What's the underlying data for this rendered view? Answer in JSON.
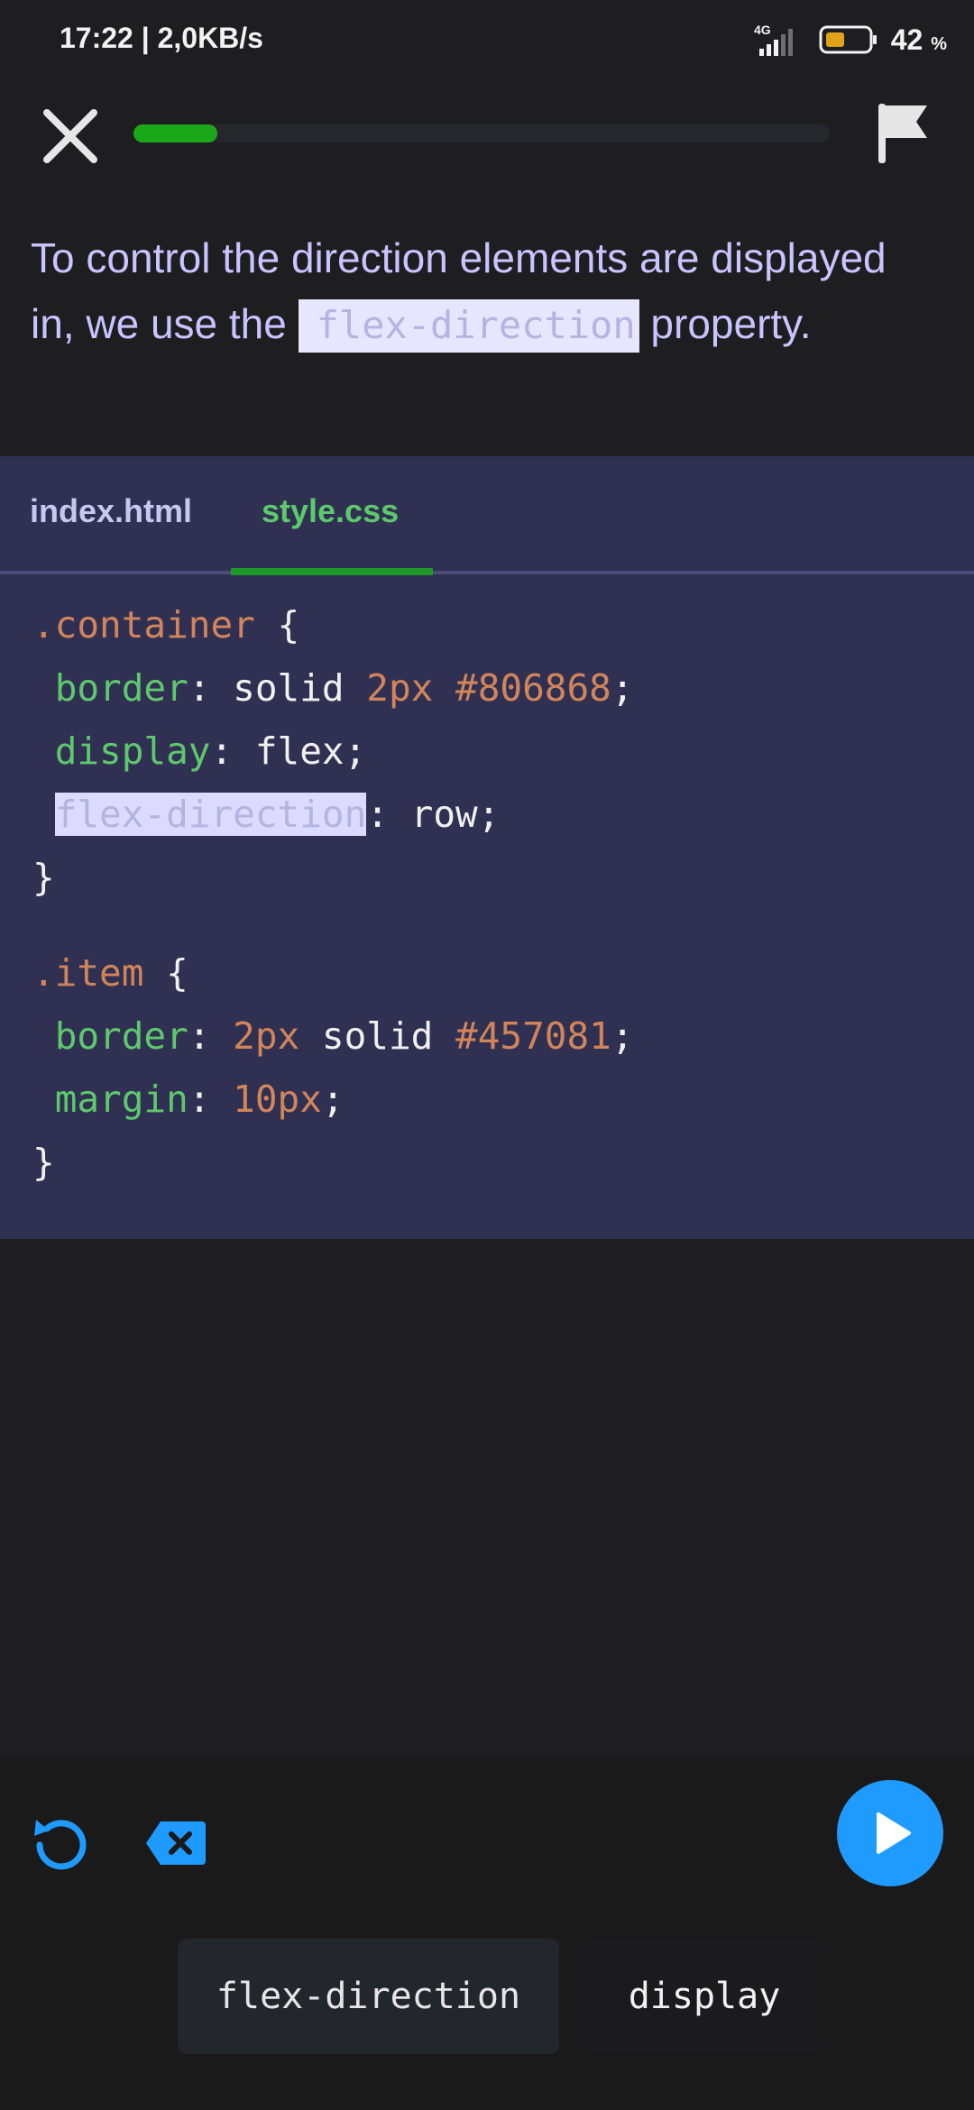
{
  "status": {
    "time": "17:22",
    "speed": "2,0KB/s",
    "network": "4G",
    "battery_pct": "42",
    "battery_unit": "%"
  },
  "lesson": {
    "progress": 0.12
  },
  "instruction": {
    "before": "To control the direction elements are displayed in, we use the ",
    "code": "flex-direction",
    "after": " property."
  },
  "editor": {
    "tabs": [
      {
        "label": "index.html",
        "active": false
      },
      {
        "label": "style.css",
        "active": true
      }
    ],
    "code": {
      "l1_selector": ".container",
      "l1_brace": " {",
      "l2_prop": "border",
      "l2_colon": ": ",
      "l2_val1": "solid ",
      "l2_num": "2px ",
      "l2_color": "#806868",
      "l2_end": ";",
      "l3_prop": "display",
      "l3_rest": ": flex;",
      "l4_prop": "flex-direction",
      "l4_rest": ": row;",
      "l5": "}",
      "l6_selector": ".item",
      "l6_brace": " {",
      "l7_prop": "border",
      "l7_colon": ": ",
      "l7_num": "2px",
      "l7_val": " solid ",
      "l7_color": "#457081",
      "l7_end": ";",
      "l8_prop": "margin",
      "l8_colon": ": ",
      "l8_num": "10px",
      "l8_end": ";",
      "l9": "}"
    }
  },
  "options": [
    "flex-direction",
    "display"
  ],
  "colors": {
    "accent": "#1f9bff",
    "progress": "#1aa81a",
    "editor_bg": "#303152"
  },
  "icons": {
    "close": "close-icon",
    "flag": "flag-icon",
    "reset": "reset-icon",
    "delete": "backspace-icon",
    "run": "play-icon"
  }
}
